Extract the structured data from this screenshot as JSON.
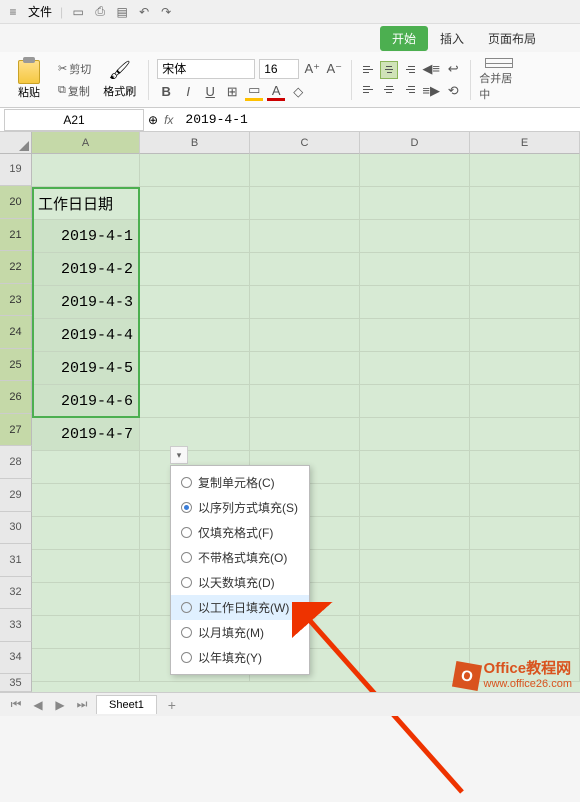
{
  "titlebar": {
    "file": "文件"
  },
  "tabs": {
    "start": "开始",
    "insert": "插入",
    "layout": "页面布局"
  },
  "ribbon": {
    "paste": "粘贴",
    "cut": "剪切",
    "copy": "复制",
    "format_painter": "格式刷",
    "font_name": "宋体",
    "font_size": "16",
    "merge": "合并居中"
  },
  "namebox": "A21",
  "formula": "2019-4-1",
  "columns": [
    "A",
    "B",
    "C",
    "D",
    "E"
  ],
  "rows": [
    "19",
    "20",
    "21",
    "22",
    "23",
    "24",
    "25",
    "26",
    "27",
    "28",
    "29",
    "30",
    "31",
    "32",
    "33",
    "34",
    "35"
  ],
  "cells": {
    "header_label": "工作日日期",
    "data": [
      "2019-4-1",
      "2019-4-2",
      "2019-4-3",
      "2019-4-4",
      "2019-4-5",
      "2019-4-6",
      "2019-4-7"
    ]
  },
  "autofill_menu": {
    "items": [
      {
        "label": "复制单元格(C)",
        "checked": false
      },
      {
        "label": "以序列方式填充(S)",
        "checked": true
      },
      {
        "label": "仅填充格式(F)",
        "checked": false
      },
      {
        "label": "不带格式填充(O)",
        "checked": false
      },
      {
        "label": "以天数填充(D)",
        "checked": false
      },
      {
        "label": "以工作日填充(W)",
        "checked": false,
        "hover": true
      },
      {
        "label": "以月填充(M)",
        "checked": false
      },
      {
        "label": "以年填充(Y)",
        "checked": false
      }
    ]
  },
  "sheet_tab": "Sheet1",
  "watermark": {
    "brand1": "Office",
    "brand2": "教程网",
    "url": "www.office26.com"
  }
}
